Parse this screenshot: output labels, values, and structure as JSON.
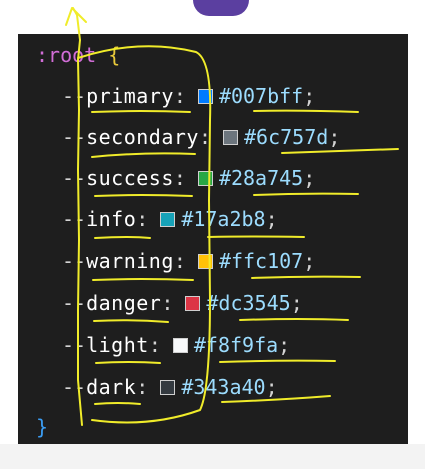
{
  "code": {
    "selector": ":root",
    "open_brace": "{",
    "close_brace": "}",
    "dashes": "--",
    "colon": ":",
    "semicolon": ";",
    "properties": [
      {
        "name": "primary",
        "value": "#007bff",
        "swatch": "#007bff"
      },
      {
        "name": "secondary",
        "value": "#6c757d",
        "swatch": "#6c757d"
      },
      {
        "name": "success",
        "value": "#28a745",
        "swatch": "#28a745"
      },
      {
        "name": "info",
        "value": "#17a2b8",
        "swatch": "#17a2b8"
      },
      {
        "name": "warning",
        "value": "#ffc107",
        "swatch": "#ffc107"
      },
      {
        "name": "danger",
        "value": "#dc3545",
        "swatch": "#dc3545"
      },
      {
        "name": "light",
        "value": "#f8f9fa",
        "swatch": "#f8f9fa"
      },
      {
        "name": "dark",
        "value": "#343a40",
        "swatch": "#343a40"
      }
    ]
  },
  "colors": {
    "editor_background": "#1e1e1e",
    "annotation_ink": "#f0ec2a"
  }
}
